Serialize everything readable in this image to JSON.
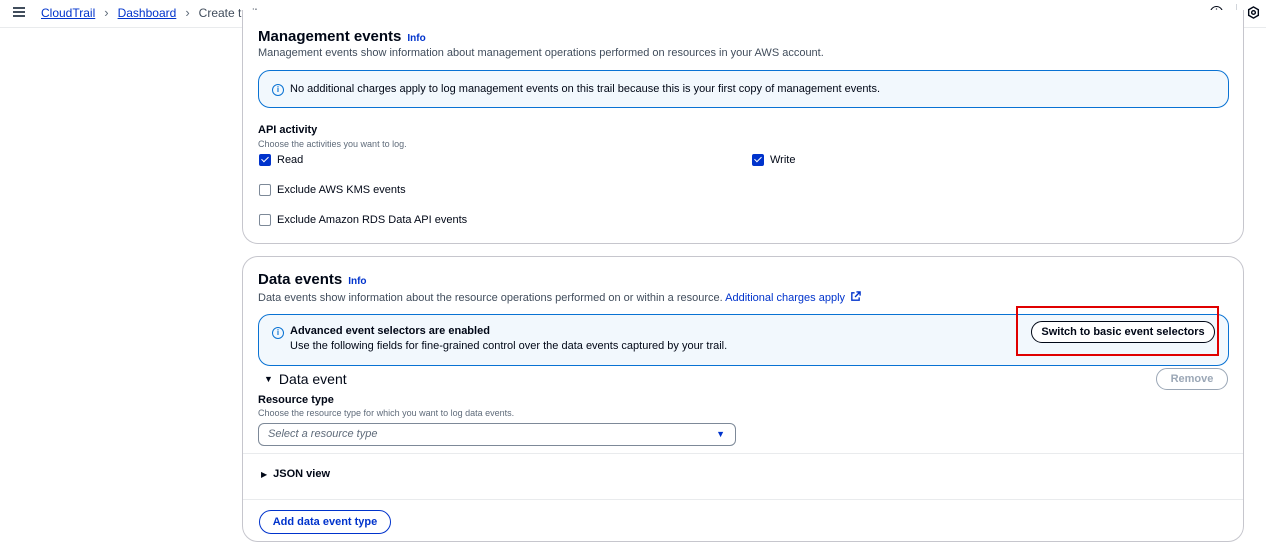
{
  "breadcrumb": {
    "items": [
      "CloudTrail",
      "Dashboard"
    ],
    "current": "Create trail"
  },
  "management": {
    "title": "Management events",
    "info": "Info",
    "description": "Management events show information about management operations performed on resources in your AWS account.",
    "alert": "No additional charges apply to log management events on this trail because this is your first copy of management events.",
    "api_label": "API activity",
    "api_desc": "Choose the activities you want to log.",
    "read": "Read",
    "write": "Write",
    "exclude_kms": "Exclude AWS KMS events",
    "exclude_rds": "Exclude Amazon RDS Data API events"
  },
  "data_events": {
    "title": "Data events",
    "info": "Info",
    "description": "Data events show information about the resource operations performed on or within a resource.",
    "charges_link": "Additional charges apply",
    "alert_title": "Advanced event selectors are enabled",
    "alert_body": "Use the following fields for fine-grained control over the data events captured by your trail.",
    "switch_button": "Switch to basic event selectors",
    "data_event_heading": "Data event",
    "remove_button": "Remove",
    "resource_type_label": "Resource type",
    "resource_type_desc": "Choose the resource type for which you want to log data events.",
    "resource_type_placeholder": "Select a resource type",
    "json_view": "JSON view",
    "add_button": "Add data event type"
  },
  "state": {
    "read_checked": true,
    "write_checked": true,
    "exclude_kms_checked": false,
    "exclude_rds_checked": false
  },
  "colors": {
    "link": "#0033cc",
    "info_blue": "#0972d3",
    "alert_bg": "#f2f8fd",
    "highlight_red": "#e00000"
  }
}
